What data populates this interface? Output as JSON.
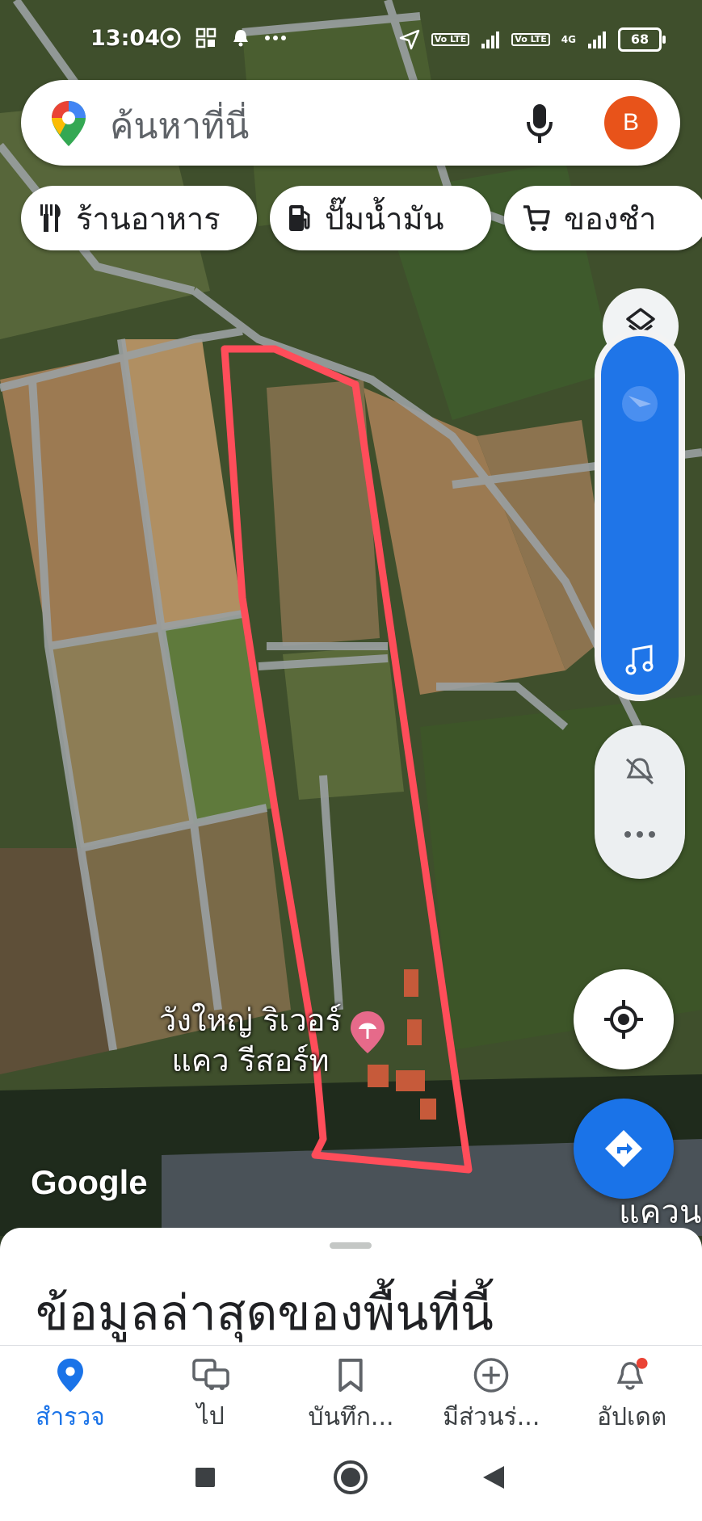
{
  "status_bar": {
    "time": "13:04",
    "lte_1": "Vo LTE",
    "lte_2": "Vo LTE",
    "network": "4G",
    "battery": "68"
  },
  "search": {
    "placeholder": "ค้นหาที่นี่",
    "avatar_letter": "B"
  },
  "chips": [
    {
      "label": "ร้านอาหาร",
      "icon": "restaurant-icon"
    },
    {
      "label": "ปั๊มน้ำมัน",
      "icon": "gas-station-icon"
    },
    {
      "label": "ของชำ",
      "icon": "cart-icon"
    }
  ],
  "map": {
    "place_label_line1": "วังใหญ่ ริเวอร์",
    "place_label_line2": "แคว รีสอร์ท",
    "edge_label": "แควน",
    "logo": "Google"
  },
  "sheet": {
    "title": "ข้อมูลล่าสุดของพื้นที่นี้"
  },
  "bottom_nav": [
    {
      "label": "สำรวจ",
      "icon": "explore-pin-icon",
      "active": true
    },
    {
      "label": "ไป",
      "icon": "commute-icon",
      "active": false
    },
    {
      "label": "บันทึก...",
      "icon": "bookmark-icon",
      "active": false
    },
    {
      "label": "มีส่วนร่...",
      "icon": "contribute-plus-icon",
      "active": false
    },
    {
      "label": "อัปเดต",
      "icon": "bell-icon",
      "active": false
    }
  ],
  "colors": {
    "accent": "#1a73e8",
    "avatar": "#e8531a",
    "outline": "#ff4d5a"
  }
}
